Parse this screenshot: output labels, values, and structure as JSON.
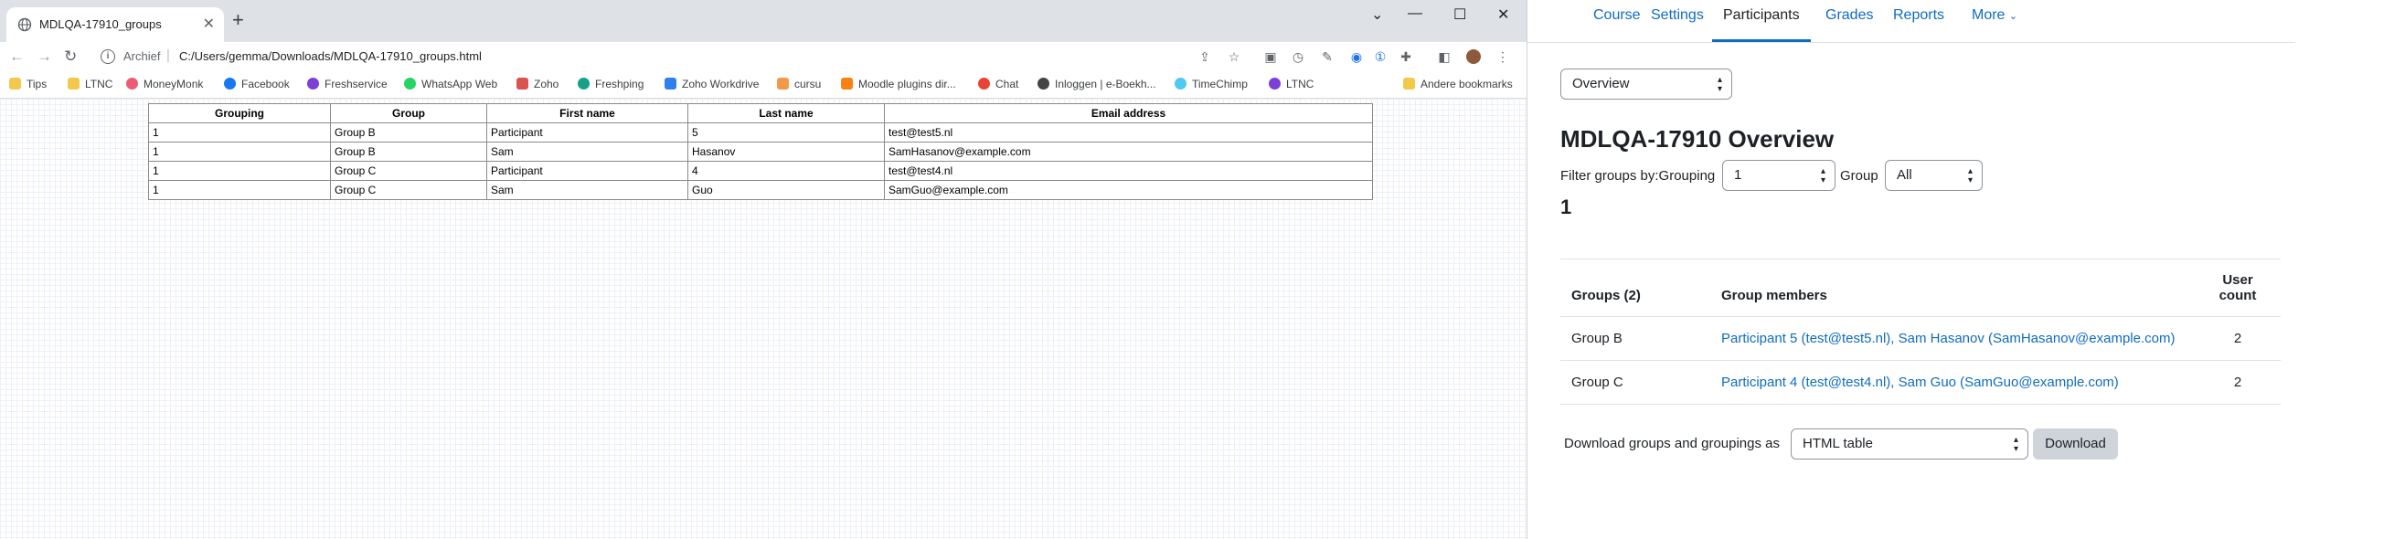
{
  "browser": {
    "tab_title": "MDLQA-17910_groups",
    "new_tab": "+",
    "window_controls": [
      "⌄",
      "—",
      "☐",
      "✕"
    ],
    "url_scheme": "Archief",
    "url_path": "C:/Users/gemma/Downloads/MDLQA-17910_groups.html",
    "bookmarks": [
      {
        "label": "Tips",
        "icon": "folder-icon",
        "color": "#f2c94c"
      },
      {
        "label": "LTNC",
        "icon": "folder-icon",
        "color": "#f2c94c"
      },
      {
        "label": "MoneyMonk",
        "icon": "moneymonk-icon",
        "color": "#e85d75"
      },
      {
        "label": "Facebook",
        "icon": "facebook-icon",
        "color": "#1877f2"
      },
      {
        "label": "Freshservice",
        "icon": "freshservice-icon",
        "color": "#7b3fd8"
      },
      {
        "label": "WhatsApp Web",
        "icon": "whatsapp-icon",
        "color": "#25d366"
      },
      {
        "label": "Zoho",
        "icon": "zoho-icon",
        "color": "#d9534f"
      },
      {
        "label": "Freshping",
        "icon": "freshping-icon",
        "color": "#16a085"
      },
      {
        "label": "Zoho Workdrive",
        "icon": "workdrive-icon",
        "color": "#2f80ed"
      },
      {
        "label": "cursu",
        "icon": "cursu-icon",
        "color": "#f2994a"
      },
      {
        "label": "Moodle plugins dir...",
        "icon": "moodle-icon",
        "color": "#f98012"
      },
      {
        "label": "Chat",
        "icon": "chat-icon",
        "color": "#ea4335"
      },
      {
        "label": "Inloggen | e-Boekh...",
        "icon": "eboekh-icon",
        "color": "#444444"
      },
      {
        "label": "TimeChimp",
        "icon": "timechimp-icon",
        "color": "#4ec9f0"
      },
      {
        "label": "LTNC",
        "icon": "ltnc-icon",
        "color": "#7b3fd8"
      }
    ],
    "other_bookmarks": "Andere bookmarks"
  },
  "groups_table": {
    "headers": [
      "Grouping",
      "Group",
      "First name",
      "Last name",
      "Email address"
    ],
    "rows": [
      [
        "1",
        "Group B",
        "Participant",
        "5",
        "test@test5.nl"
      ],
      [
        "1",
        "Group B",
        "Sam",
        "Hasanov",
        "SamHasanov@example.com"
      ],
      [
        "1",
        "Group C",
        "Participant",
        "4",
        "test@test4.nl"
      ],
      [
        "1",
        "Group C",
        "Sam",
        "Guo",
        "SamGuo@example.com"
      ]
    ]
  },
  "moodle": {
    "nav": [
      "Course",
      "Settings",
      "Participants",
      "Grades",
      "Reports",
      "More"
    ],
    "nav_active": "Participants",
    "view_select": "Overview",
    "heading": "MDLQA-17910 Overview",
    "filter_label": "Filter groups by:Grouping",
    "grouping_select": "1",
    "group_label": "Group",
    "group_select": "All",
    "grouping_heading": "1",
    "overview": {
      "headers": [
        "Groups (2)",
        "Group members",
        "User count"
      ],
      "rows": [
        [
          "Group B",
          "Participant 5 (test@test5.nl), Sam Hasanov (SamHasanov@example.com)",
          "2"
        ],
        [
          "Group C",
          "Participant 4 (test@test4.nl), Sam Guo (SamGuo@example.com)",
          "2"
        ]
      ]
    },
    "download_label": "Download groups and groupings as",
    "download_format": "HTML table",
    "download_button": "Download",
    "accent_color": "#0f6cbf"
  }
}
